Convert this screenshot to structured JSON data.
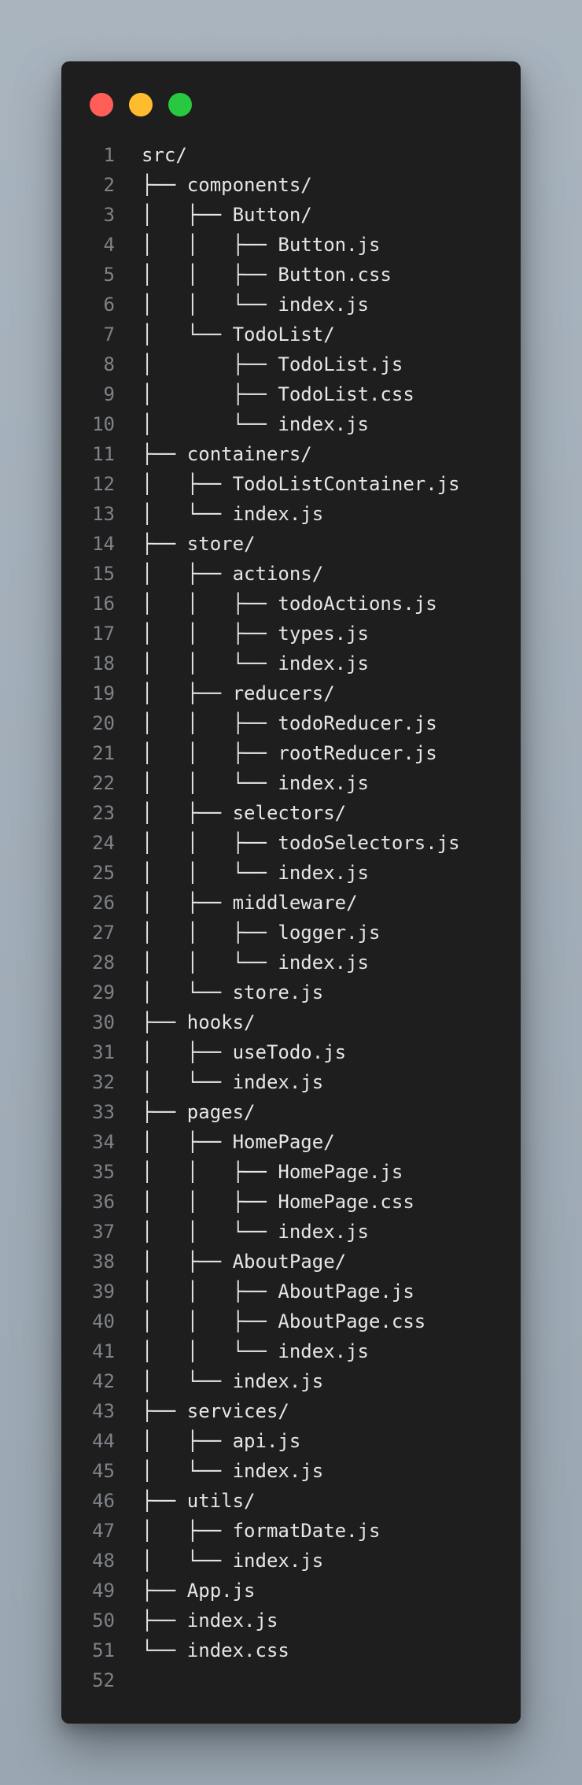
{
  "window": {
    "controls": [
      {
        "name": "close-button",
        "color": "#ff5f57"
      },
      {
        "name": "minimize-button",
        "color": "#febc2e"
      },
      {
        "name": "maximize-button",
        "color": "#28c840"
      }
    ]
  },
  "code": {
    "lines": [
      {
        "n": "1",
        "text": "src/"
      },
      {
        "n": "2",
        "text": "├── components/"
      },
      {
        "n": "3",
        "text": "│   ├── Button/"
      },
      {
        "n": "4",
        "text": "│   │   ├── Button.js"
      },
      {
        "n": "5",
        "text": "│   │   ├── Button.css"
      },
      {
        "n": "6",
        "text": "│   │   └── index.js"
      },
      {
        "n": "7",
        "text": "│   └── TodoList/"
      },
      {
        "n": "8",
        "text": "│       ├── TodoList.js"
      },
      {
        "n": "9",
        "text": "│       ├── TodoList.css"
      },
      {
        "n": "10",
        "text": "│       └── index.js"
      },
      {
        "n": "11",
        "text": "├── containers/"
      },
      {
        "n": "12",
        "text": "│   ├── TodoListContainer.js"
      },
      {
        "n": "13",
        "text": "│   └── index.js"
      },
      {
        "n": "14",
        "text": "├── store/"
      },
      {
        "n": "15",
        "text": "│   ├── actions/"
      },
      {
        "n": "16",
        "text": "│   │   ├── todoActions.js"
      },
      {
        "n": "17",
        "text": "│   │   ├── types.js"
      },
      {
        "n": "18",
        "text": "│   │   └── index.js"
      },
      {
        "n": "19",
        "text": "│   ├── reducers/"
      },
      {
        "n": "20",
        "text": "│   │   ├── todoReducer.js"
      },
      {
        "n": "21",
        "text": "│   │   ├── rootReducer.js"
      },
      {
        "n": "22",
        "text": "│   │   └── index.js"
      },
      {
        "n": "23",
        "text": "│   ├── selectors/"
      },
      {
        "n": "24",
        "text": "│   │   ├── todoSelectors.js"
      },
      {
        "n": "25",
        "text": "│   │   └── index.js"
      },
      {
        "n": "26",
        "text": "│   ├── middleware/"
      },
      {
        "n": "27",
        "text": "│   │   ├── logger.js"
      },
      {
        "n": "28",
        "text": "│   │   └── index.js"
      },
      {
        "n": "29",
        "text": "│   └── store.js"
      },
      {
        "n": "30",
        "text": "├── hooks/"
      },
      {
        "n": "31",
        "text": "│   ├── useTodo.js"
      },
      {
        "n": "32",
        "text": "│   └── index.js"
      },
      {
        "n": "33",
        "text": "├── pages/"
      },
      {
        "n": "34",
        "text": "│   ├── HomePage/"
      },
      {
        "n": "35",
        "text": "│   │   ├── HomePage.js"
      },
      {
        "n": "36",
        "text": "│   │   ├── HomePage.css"
      },
      {
        "n": "37",
        "text": "│   │   └── index.js"
      },
      {
        "n": "38",
        "text": "│   ├── AboutPage/"
      },
      {
        "n": "39",
        "text": "│   │   ├── AboutPage.js"
      },
      {
        "n": "40",
        "text": "│   │   ├── AboutPage.css"
      },
      {
        "n": "41",
        "text": "│   │   └── index.js"
      },
      {
        "n": "42",
        "text": "│   └── index.js"
      },
      {
        "n": "43",
        "text": "├── services/"
      },
      {
        "n": "44",
        "text": "│   ├── api.js"
      },
      {
        "n": "45",
        "text": "│   └── index.js"
      },
      {
        "n": "46",
        "text": "├── utils/"
      },
      {
        "n": "47",
        "text": "│   ├── formatDate.js"
      },
      {
        "n": "48",
        "text": "│   └── index.js"
      },
      {
        "n": "49",
        "text": "├── App.js"
      },
      {
        "n": "50",
        "text": "├── index.js"
      },
      {
        "n": "51",
        "text": "└── index.css"
      },
      {
        "n": "52",
        "text": ""
      }
    ]
  }
}
